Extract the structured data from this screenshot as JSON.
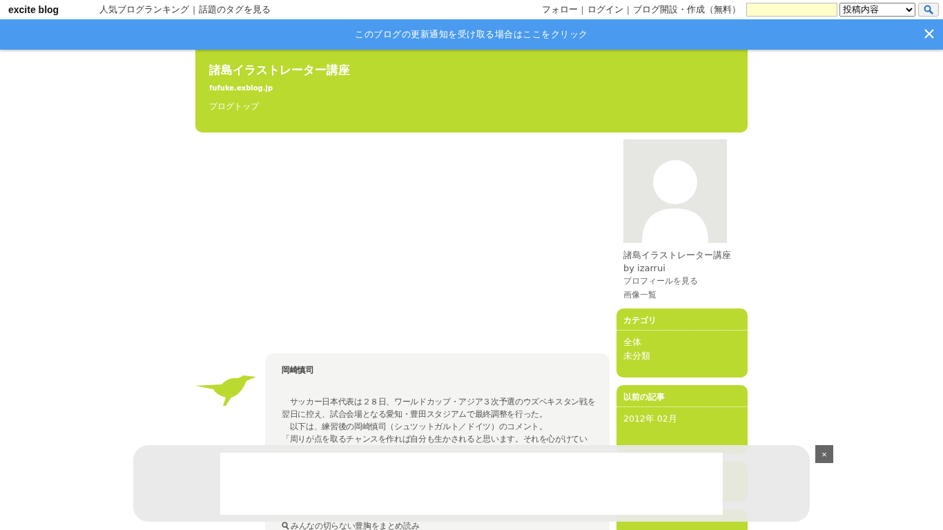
{
  "topbar": {
    "logo": "excite blog",
    "nav_links": [
      {
        "kind": "link",
        "text": "人気ブログランキング"
      },
      {
        "kind": "separator",
        "text": "|"
      },
      {
        "kind": "link",
        "text": "話題のタグを見る"
      }
    ],
    "user_links": [
      {
        "kind": "link",
        "text": "フォロー"
      },
      {
        "kind": "separator",
        "text": "|"
      },
      {
        "kind": "link",
        "text": "ログイン"
      },
      {
        "kind": "separator",
        "text": "|"
      },
      {
        "kind": "link",
        "text": "ブログ開設・作成（無料）"
      }
    ],
    "scope_select": {
      "value": "投稿内容"
    }
  },
  "notice": {
    "text": "このブログの更新通知を受け取る場合はここをクリック"
  },
  "header": {
    "title": "諸島イラストレーター講座",
    "url": "fufuke.exblog.jp",
    "nav": [
      "ブログトップ"
    ]
  },
  "post": {
    "title": "岡崎慎司",
    "paragraphs": [
      "　サッカー日本代表は２８日、ワールドカップ・アジア３次予選のウズベキスタン戦を翌日に控え、試合会場となる愛知・豊田スタジアムで最終調整を行った。",
      "　以下は、練習後の岡崎慎司（シュツットガルト／ドイツ）のコメント。",
      "「周りが点を取るチャンスを作れば自分も生かされると思います。それを心がけてい"
    ],
    "link": "みんなの切らない豊胸をまとめ読み"
  },
  "profile": {
    "name": "諸島イラストレーター講座",
    "by": "by izarrui",
    "links": [
      "プロフィールを見る",
      "画像一覧"
    ]
  },
  "side_cards": [
    {
      "title": "カテゴリ",
      "items": [
        "全体",
        "未分類"
      ]
    },
    {
      "title": "以前の記事",
      "items": [
        "2012年 02月"
      ]
    }
  ],
  "ad_overlay": {
    "close": "×"
  }
}
